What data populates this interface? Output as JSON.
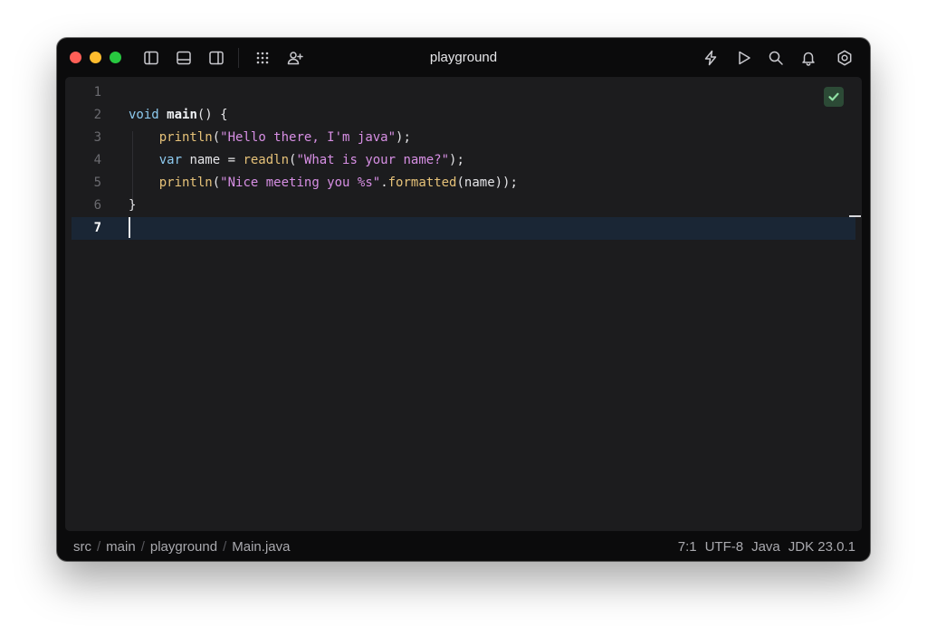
{
  "window": {
    "title": "playground"
  },
  "editor": {
    "lines": [
      {
        "num": "1",
        "tokens": []
      },
      {
        "num": "2",
        "tokens": [
          {
            "cls": "t-kw",
            "text": "void "
          },
          {
            "cls": "t-fn",
            "text": "main"
          },
          {
            "cls": "t-pl",
            "text": "() {"
          }
        ]
      },
      {
        "num": "3",
        "tokens": [
          {
            "cls": "t-pl",
            "text": "    "
          },
          {
            "cls": "t-call",
            "text": "println"
          },
          {
            "cls": "t-pl",
            "text": "("
          },
          {
            "cls": "t-str",
            "text": "\"Hello there, I'm java\""
          },
          {
            "cls": "t-pl",
            "text": ");"
          }
        ]
      },
      {
        "num": "4",
        "tokens": [
          {
            "cls": "t-pl",
            "text": "    "
          },
          {
            "cls": "t-kw",
            "text": "var "
          },
          {
            "cls": "t-pl",
            "text": "name = "
          },
          {
            "cls": "t-call",
            "text": "readln"
          },
          {
            "cls": "t-pl",
            "text": "("
          },
          {
            "cls": "t-str",
            "text": "\"What is your name?\""
          },
          {
            "cls": "t-pl",
            "text": ");"
          }
        ]
      },
      {
        "num": "5",
        "tokens": [
          {
            "cls": "t-pl",
            "text": "    "
          },
          {
            "cls": "t-call",
            "text": "println"
          },
          {
            "cls": "t-pl",
            "text": "("
          },
          {
            "cls": "t-str",
            "text": "\"Nice meeting you %s\""
          },
          {
            "cls": "t-pl",
            "text": "."
          },
          {
            "cls": "t-call",
            "text": "formatted"
          },
          {
            "cls": "t-pl",
            "text": "(name));"
          }
        ]
      },
      {
        "num": "6",
        "tokens": [
          {
            "cls": "t-pl",
            "text": "}"
          }
        ]
      },
      {
        "num": "7",
        "tokens": [],
        "current": true
      }
    ]
  },
  "toolbar": {
    "left_icons": [
      "sidebar-left-icon",
      "panel-bottom-icon",
      "sidebar-right-icon",
      "grid-dots-icon",
      "add-user-icon"
    ],
    "right_icons": [
      "lightning-icon",
      "play-icon",
      "search-icon",
      "bell-icon",
      "settings-icon"
    ]
  },
  "status": {
    "breadcrumbs": [
      "src",
      "main",
      "playground",
      "Main.java"
    ],
    "cursor_pos": "7:1",
    "encoding": "UTF-8",
    "language": "Java",
    "jdk": "JDK 23.0.1"
  }
}
